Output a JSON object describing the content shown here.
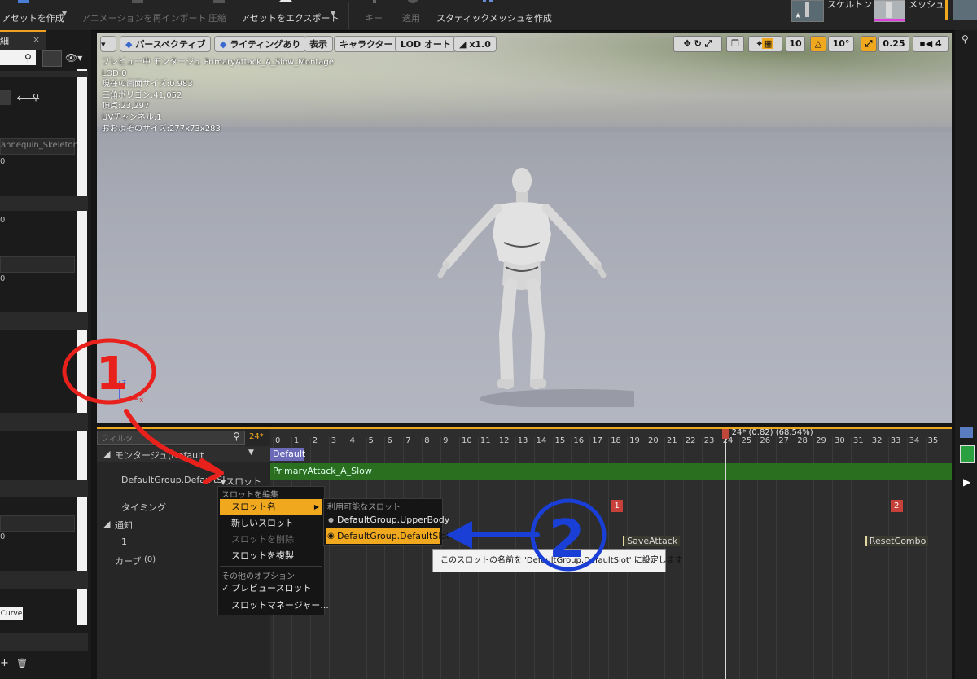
{
  "toolbar": {
    "items": [
      {
        "label": "アセットを作成",
        "enabled": true
      },
      {
        "label": "アニメーションを再インポート",
        "enabled": false
      },
      {
        "label": "圧縮",
        "enabled": false
      },
      {
        "label": "アセットをエクスポート",
        "enabled": true
      },
      {
        "label": "キー",
        "enabled": false
      },
      {
        "label": "適用",
        "enabled": false
      },
      {
        "label": "スタティックメッシュを作成",
        "enabled": true
      }
    ],
    "mode_tabs": [
      {
        "label": "スケルトン"
      },
      {
        "label": "メッシュ"
      }
    ]
  },
  "left_panel": {
    "tab_label": "細",
    "skeleton_text": "annequin_Skeleton",
    "value_zero": "0",
    "curve_button": "Curve"
  },
  "viewport": {
    "buttons": {
      "perspective": "パースペクティブ",
      "lighting": "ライティングあり",
      "show": "表示",
      "character": "キャラクター",
      "lod": "LOD オート",
      "speed": "x1.0"
    },
    "info_lines": [
      "プレビュー中 モンタージュ PrimaryAttack_A_Slow_Montage",
      "LOD:0",
      "現在の画面サイズ:0.983",
      "三角ポリゴン:41,052",
      "頂点:23,297",
      "UVチャンネル:1",
      "おおよそのサイズ:277x73x283"
    ],
    "snap": {
      "grid": "10",
      "rotation": "10°",
      "scale": "0.25",
      "camera_speed": "4"
    },
    "axis": {
      "z": "z",
      "x": "x"
    }
  },
  "timeline": {
    "filter_placeholder": "フィルタ",
    "frame_badge": "24*",
    "playhead_label": "24* (0.82) (68.54%)",
    "tick_labels": [
      "0",
      "1",
      "2",
      "3",
      "4",
      "5",
      "6",
      "7",
      "8",
      "9",
      "10",
      "11",
      "12",
      "13",
      "14",
      "15",
      "16",
      "17",
      "18",
      "19",
      "20",
      "21",
      "22",
      "23",
      "24",
      "25",
      "26",
      "27",
      "28",
      "29",
      "30",
      "31",
      "32",
      "33",
      "34",
      "35"
    ],
    "rows": {
      "montage": "モンタージュ(Default",
      "slot_name": "DefaultGroup.DefaultSl",
      "slot_dropdown": "スロット",
      "timing": "タイミング",
      "notify": "通知",
      "notify_track": "1",
      "curve": "カーブ",
      "curve_count": "(0)"
    },
    "section_label": "Default",
    "segment_label": "PrimaryAttack_A_Slow",
    "timing_markers": [
      {
        "label": "1",
        "frame": 18
      },
      {
        "label": "2",
        "frame": 33
      }
    ],
    "notifies": [
      {
        "label": "SaveAttack",
        "frame": 19
      },
      {
        "label": "ResetCombo",
        "frame": 32
      }
    ],
    "playhead_frame": 24
  },
  "slot_menu": {
    "header_edit": "スロットを編集",
    "slot_name": "スロット名",
    "new_slot": "新しいスロット",
    "delete_slot": "スロットを削除",
    "duplicate_slot": "スロットを複製",
    "header_other": "その他のオプション",
    "preview_slot": "プレビュースロット",
    "slot_manager": "スロットマネージャー..."
  },
  "submenu": {
    "header": "利用可能なスロット",
    "items": [
      "DefaultGroup.UpperBody",
      "DefaultGroup.DefaultSlot"
    ]
  },
  "tooltip": "このスロットの名前を 'DefaultGroup.DefaultSlot' に設定します",
  "annotations": {
    "one": "1",
    "two": "2"
  },
  "colors": {
    "accent": "#f0a81e",
    "segment": "#2a6e1f",
    "section": "#6a6ab8",
    "marker": "#c8403a",
    "annotation_red": "#e8211c",
    "annotation_blue": "#1a3fd6"
  }
}
